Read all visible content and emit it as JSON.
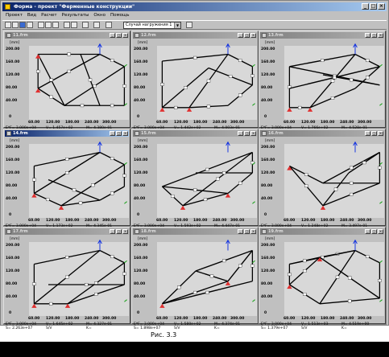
{
  "app": {
    "title": "Форма - проект \"Ферменные конструкции\"",
    "menu": [
      "Проект",
      "Вид",
      "Расчет",
      "Результаты",
      "Окно",
      "Помощь"
    ],
    "combo_value": "Случай нагружения 1"
  },
  "units_label": "[mm]",
  "y_ticks": [
    "200.00",
    "160.00",
    "120.00",
    "80.00",
    "40.00"
  ],
  "y_tick_zero": "0",
  "x_ticks": [
    "60.00",
    "120.00",
    "180.00",
    "240.00",
    "300.00"
  ],
  "windows": [
    {
      "name": "11.frm",
      "ey": "3.000e+04",
      "v": "1.457e+02",
      "m": "4.380e-01",
      "s": "1.847e+07"
    },
    {
      "name": "12.frm",
      "ey": "3.000e+04",
      "v": "1.442e+02",
      "m": "4.003e-01",
      "s": "1.723e+07"
    },
    {
      "name": "13.frm",
      "ey": "3.000e+04",
      "v": "1.766e+02",
      "m": "4.528e-01",
      "s": "1.307e+07"
    },
    {
      "name": "14.frm",
      "ey": "3.000e+04",
      "v": "1.173e+02",
      "m": "4.345e-01",
      "s": "4.073e+07"
    },
    {
      "name": "15.frm",
      "ey": "3.000e+04",
      "v": "1.593e+02",
      "m": "4.447e-01",
      "s": "2.458e+07"
    },
    {
      "name": "16.frm",
      "ey": "3.000e+04",
      "v": "1.248e+02",
      "m": "3.497e-01",
      "s": "2.880e+03"
    },
    {
      "name": "17.frm",
      "ey": "3.000e+04",
      "v": "1.645e+02",
      "m": "4.327e-01",
      "s": "2.263e+07"
    },
    {
      "name": "18.frm",
      "ey": "3.000e+04",
      "v": "1.580e+02",
      "m": "4.374e-01",
      "s": "1.898e+07"
    },
    {
      "name": "19.frm",
      "ey": "3.000e+04",
      "v": "1.513e+03",
      "m": "4.519e+00",
      "s": "1.379e+07"
    }
  ],
  "labels": {
    "ey": "E*F=",
    "v": "V=",
    "m": "M=",
    "s": "S=",
    "sv": "S/V",
    "k": "K="
  },
  "caption": "Рис. 3.3"
}
